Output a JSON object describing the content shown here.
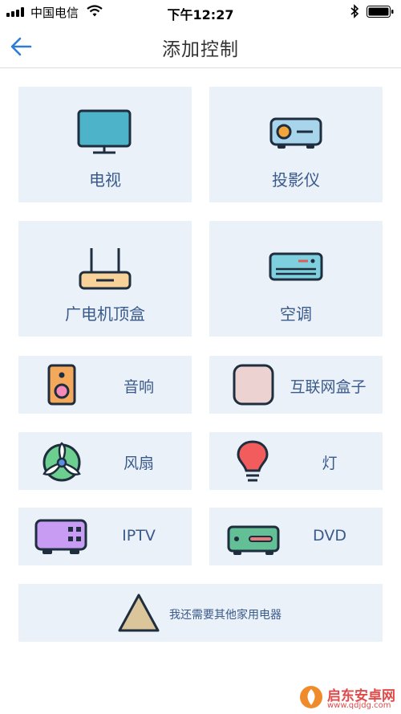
{
  "status_bar": {
    "carrier": "中国电信",
    "time": "下午12:27"
  },
  "nav": {
    "title": "添加控制"
  },
  "devices": {
    "tv": "电视",
    "projector": "投影仪",
    "set_top_box": "广电机顶盒",
    "air_conditioner": "空调",
    "speaker": "音响",
    "internet_box": "互联网盒子",
    "fan": "风扇",
    "light": "灯",
    "iptv": "IPTV",
    "dvd": "DVD",
    "other": "我还需要其他家用电器"
  },
  "watermark": {
    "name": "启东安卓网",
    "url": "www.qdjdg.com"
  },
  "colors": {
    "tile_bg": "#ebf1f8",
    "label": "#3a5a8c",
    "accent": "#2f7cd6"
  }
}
